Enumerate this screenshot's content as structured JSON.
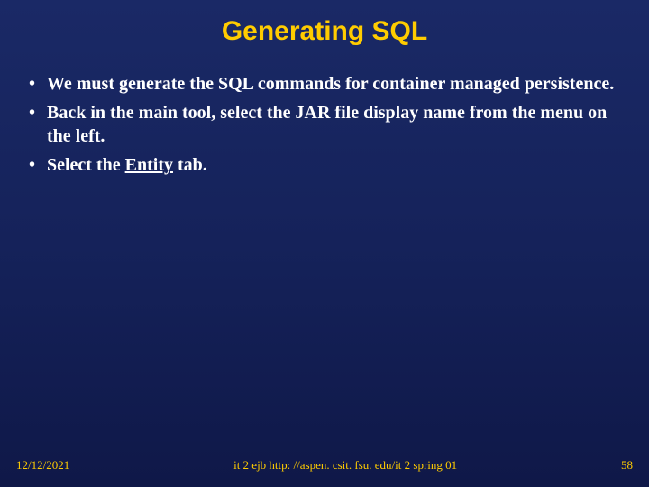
{
  "title": "Generating SQL",
  "bullets": [
    "We must generate the SQL commands for container managed persistence.",
    "Back in the main tool, select the JAR file display name from the menu on the left.",
    "Select the Entity tab."
  ],
  "bullet3_prefix": "Select the ",
  "bullet3_underlined": "Entity",
  "bullet3_suffix": " tab.",
  "footer": {
    "date": "12/12/2021",
    "center": "it 2 ejb  http: //aspen. csit. fsu. edu/it 2 spring 01",
    "page": "58"
  }
}
